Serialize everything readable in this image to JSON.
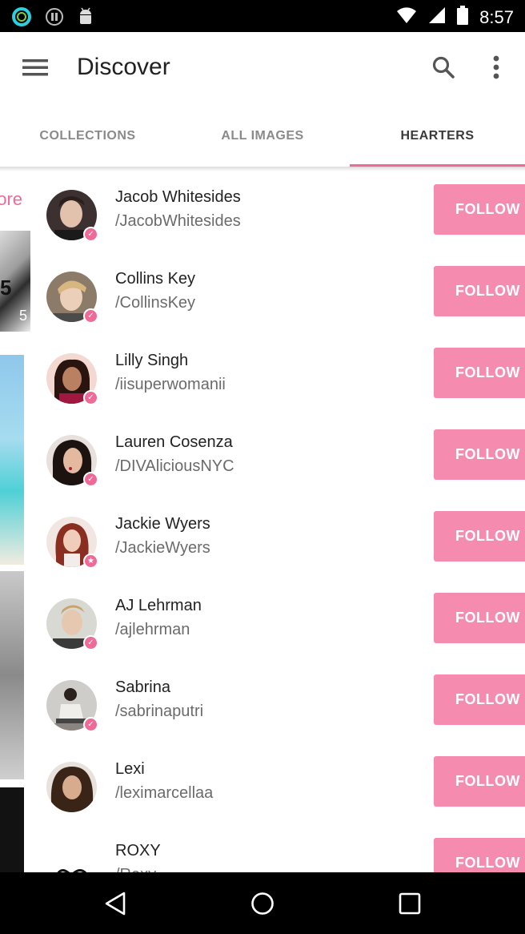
{
  "status_bar": {
    "time": "8:57",
    "left_icons": [
      "ring-icon",
      "pause-circle-icon",
      "android-icon"
    ],
    "right_icons": [
      "wifi-icon",
      "signal-icon",
      "battery-icon"
    ]
  },
  "app_bar": {
    "title": "Discover",
    "icons": [
      "menu-icon",
      "search-icon",
      "more-vert-icon"
    ]
  },
  "tabs": [
    {
      "label": "COLLECTIONS",
      "active": false
    },
    {
      "label": "ALL IMAGES",
      "active": false
    },
    {
      "label": "HEARTERS",
      "active": true
    }
  ],
  "peek": {
    "more_label": "ore",
    "image_text_1": "5",
    "image_text_2": "5"
  },
  "colors": {
    "accent": "#f06a97",
    "follow_button": "#f58cb0"
  },
  "list": [
    {
      "name": "Jacob Whitesides",
      "handle": "/JacobWhitesides",
      "badge": "check-icon",
      "button": "FOLLOW"
    },
    {
      "name": "Collins Key",
      "handle": "/CollinsKey",
      "badge": "check-icon",
      "button": "FOLLOW"
    },
    {
      "name": "Lilly Singh",
      "handle": "/iisuperwomanii",
      "badge": "check-icon",
      "button": "FOLLOW"
    },
    {
      "name": "Lauren Cosenza",
      "handle": "/DIVAliciousNYC",
      "badge": "check-icon",
      "button": "FOLLOW"
    },
    {
      "name": "Jackie Wyers",
      "handle": "/JackieWyers",
      "badge": "star-icon",
      "button": "FOLLOW"
    },
    {
      "name": "AJ Lehrman",
      "handle": "/ajlehrman",
      "badge": "check-icon",
      "button": "FOLLOW"
    },
    {
      "name": "Sabrina",
      "handle": "/sabrinaputri",
      "badge": "check-icon",
      "button": "FOLLOW"
    },
    {
      "name": "Lexi",
      "handle": "/leximarcellaa",
      "badge": "none",
      "button": "FOLLOW"
    },
    {
      "name": "ROXY",
      "handle": "/Roxy",
      "badge": "none",
      "button": "FOLLOW"
    }
  ],
  "nav_bar": {
    "icons": [
      "back-icon",
      "home-icon",
      "recents-icon"
    ]
  }
}
